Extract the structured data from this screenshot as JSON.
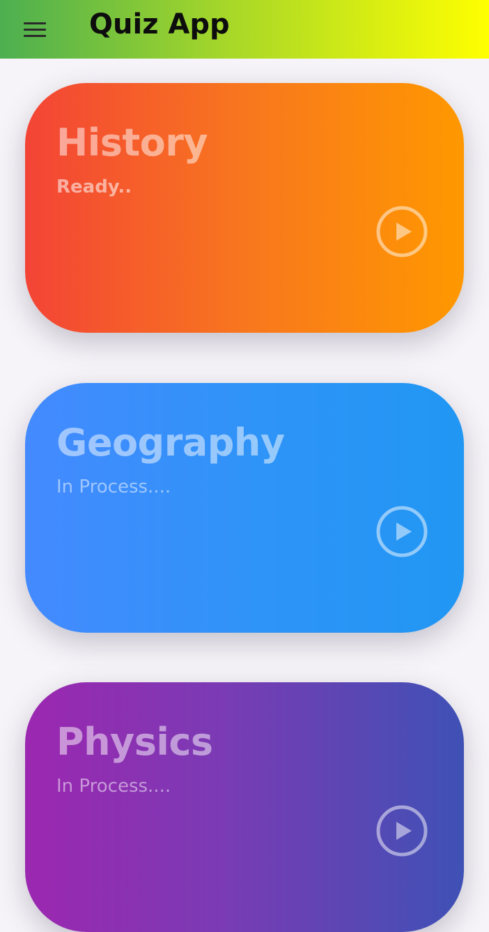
{
  "appbar": {
    "title": "Quiz App",
    "menu_icon": "menu-icon"
  },
  "cards": [
    {
      "title": "History",
      "status": "Ready..",
      "icon": "play-circle-icon"
    },
    {
      "title": "Geography",
      "status": "In Process....",
      "icon": "play-circle-icon"
    },
    {
      "title": "Physics",
      "status": "In Process....",
      "icon": "play-circle-icon"
    }
  ],
  "colors": {
    "appbar_gradient": [
      "#4caf50",
      "#ffff00"
    ],
    "history_gradient": [
      "#f34436",
      "#ff9800"
    ],
    "geography_gradient": [
      "#448aff",
      "#2196f3"
    ],
    "physics_gradient": [
      "#9c27b0",
      "#3f51b5"
    ]
  }
}
